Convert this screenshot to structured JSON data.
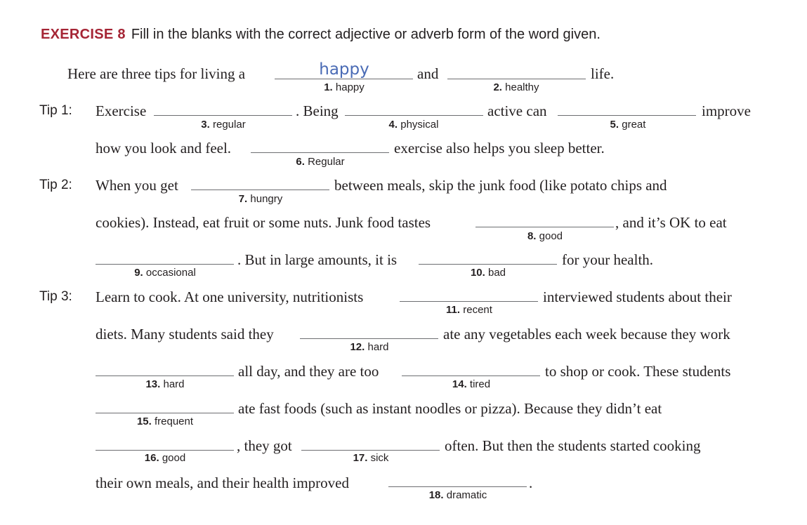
{
  "title": {
    "label": "EXERCISE 8",
    "instruction": "Fill in the blanks with the correct adjective or adverb form of the word given."
  },
  "intro": {
    "before": "Here are three tips for living a",
    "and": "and",
    "after": "life."
  },
  "tips": {
    "tip1": "Tip 1:",
    "tip2": "Tip 2:",
    "tip3": "Tip 3:"
  },
  "text": {
    "t1_exercise": "Exercise",
    "t1_being": ". Being",
    "t1_active": "active can",
    "t1_improve": "improve",
    "t1_line2a": "how you look and feel.",
    "t1_line2b": "exercise also helps you sleep better.",
    "t2_when": "When you get",
    "t2_between": "between meals, skip the junk food (like potato chips and",
    "t2_cookies": "cookies). Instead, eat fruit or some nuts. Junk food tastes",
    "t2_ok": ", and it’s OK to eat",
    "t2_but": ". But in large amounts, it is",
    "t2_health": "for your health.",
    "t3_learn": "Learn to cook. At one university, nutritionists",
    "t3_interviewed": "interviewed students about their",
    "t3_diets": "diets. Many students said they",
    "t3_ate": "ate any vegetables each week because they work",
    "t3_allday": "all day, and they are too",
    "t3_shop": "to shop or cook. These students",
    "t3_fastfood": "ate fast foods (such as instant noodles or pizza). Because they didn’t eat",
    "t3_theygot": ", they got",
    "t3_often": "often. But then the students started cooking",
    "t3_own": "their own meals, and their health improved",
    "t3_period": "."
  },
  "answers": {
    "a1": "happy"
  },
  "cues": [
    {
      "num": "1.",
      "word": "happy"
    },
    {
      "num": "2.",
      "word": "healthy"
    },
    {
      "num": "3.",
      "word": "regular"
    },
    {
      "num": "4.",
      "word": "physical"
    },
    {
      "num": "5.",
      "word": "great"
    },
    {
      "num": "6.",
      "word": "Regular"
    },
    {
      "num": "7.",
      "word": "hungry"
    },
    {
      "num": "8.",
      "word": "good"
    },
    {
      "num": "9.",
      "word": "occasional"
    },
    {
      "num": "10.",
      "word": "bad"
    },
    {
      "num": "11.",
      "word": "recent"
    },
    {
      "num": "12.",
      "word": "hard"
    },
    {
      "num": "13.",
      "word": "hard"
    },
    {
      "num": "14.",
      "word": "tired"
    },
    {
      "num": "15.",
      "word": "frequent"
    },
    {
      "num": "16.",
      "word": "good"
    },
    {
      "num": "17.",
      "word": "sick"
    },
    {
      "num": "18.",
      "word": "dramatic"
    }
  ],
  "colors": {
    "exercise_label": "#a52535",
    "handwriting": "#4a6bb5",
    "text": "#231f20"
  }
}
